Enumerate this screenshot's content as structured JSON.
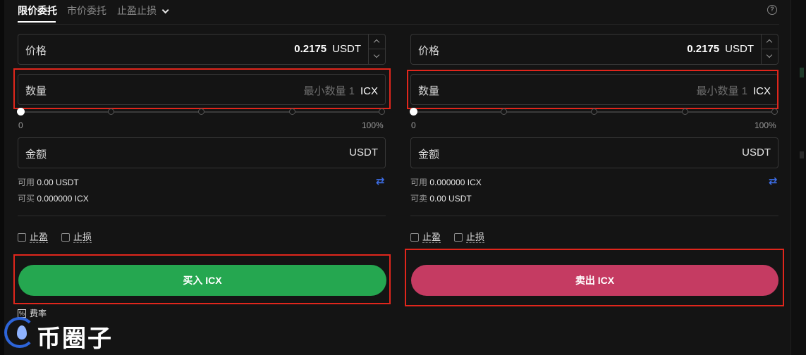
{
  "tabs": [
    {
      "label": "限价委托",
      "active": true
    },
    {
      "label": "市价委托",
      "active": false
    },
    {
      "label": "止盈止损",
      "active": false,
      "has_dropdown": true
    }
  ],
  "buy": {
    "price": {
      "label": "价格",
      "value": "0.2175",
      "unit": "USDT"
    },
    "amount": {
      "label": "数量",
      "placeholder": "最小数量 1",
      "unit": "ICX"
    },
    "slider": {
      "min_label": "0",
      "max_label": "100%",
      "value_percent": 0
    },
    "total": {
      "label": "金额",
      "unit": "USDT"
    },
    "available": {
      "label": "可用",
      "value": "0.00 USDT"
    },
    "can_trade": {
      "label": "可买",
      "value": "0.000000 ICX"
    },
    "take_profit": "止盈",
    "stop_loss": "止损",
    "button": "买入 ICX"
  },
  "sell": {
    "price": {
      "label": "价格",
      "value": "0.2175",
      "unit": "USDT"
    },
    "amount": {
      "label": "数量",
      "placeholder": "最小数量 1",
      "unit": "ICX"
    },
    "slider": {
      "min_label": "0",
      "max_label": "100%",
      "value_percent": 0
    },
    "total": {
      "label": "金额",
      "unit": "USDT"
    },
    "available": {
      "label": "可用",
      "value": "0.000000 ICX"
    },
    "can_trade": {
      "label": "可卖",
      "value": "0.00 USDT"
    },
    "take_profit": "止盈",
    "stop_loss": "止损",
    "button": "卖出 ICX"
  },
  "fee_label": "费率",
  "watermark": "币圈子",
  "colors": {
    "buy": "#25a750",
    "sell": "#c53b62",
    "swap_icon": "#3d6ee8",
    "highlight": "#e0261c"
  },
  "icons": {
    "help": "question-circle-icon",
    "swap": "swap-arrows-icon",
    "fee": "fee-icon",
    "dropdown": "chevron-down-icon"
  }
}
